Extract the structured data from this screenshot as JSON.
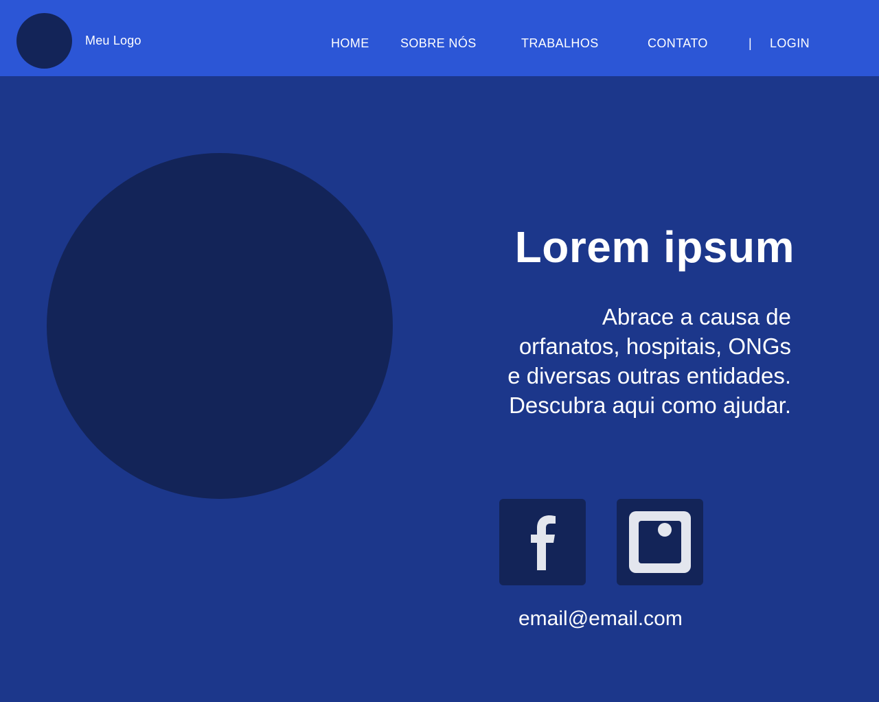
{
  "colors": {
    "header_bg": "#2c56d6",
    "page_bg": "#1c378b",
    "circle_fill": "#132458",
    "text": "#ffffff",
    "icon_glyph": "#e3e6ee"
  },
  "header": {
    "logo_text": "Meu Logo",
    "nav": [
      {
        "label": "HOME"
      },
      {
        "label": "SOBRE NÓS"
      },
      {
        "label": "TRABALHOS"
      },
      {
        "label": "CONTATO"
      }
    ],
    "separator": "|",
    "login_label": "LOGIN"
  },
  "hero": {
    "title": "Lorem ipsum",
    "lines": [
      "Abrace a causa de",
      "orfanatos, hospitais, ONGs",
      "e diversas outras entidades.",
      "Descubra aqui como ajudar."
    ]
  },
  "social": {
    "facebook_icon": "facebook-icon",
    "instagram_icon": "instagram-icon"
  },
  "contact": {
    "email": "email@email.com"
  }
}
